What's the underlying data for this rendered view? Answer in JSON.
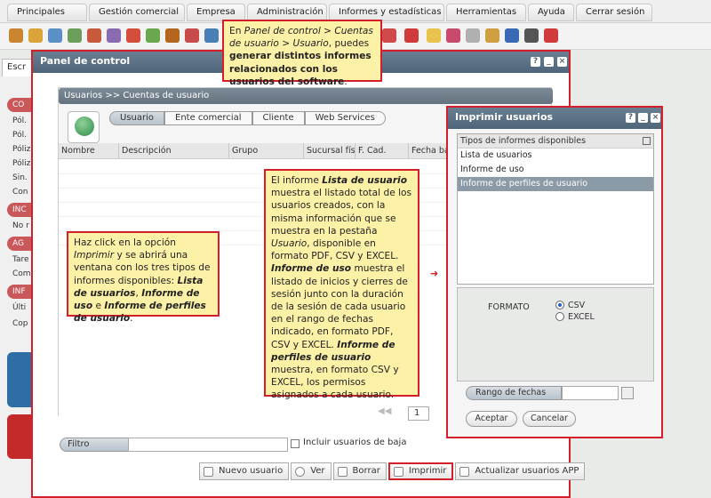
{
  "menu": [
    "Principales",
    "Gestión comercial",
    "Empresa",
    "Administración",
    "Informes y estadísticas",
    "Herramientas",
    "Ayuda",
    "Cerrar sesión"
  ],
  "background_tab": "Escr",
  "background_rows": [
    "CO",
    "Pól.",
    "Pól.",
    "Póliz",
    "Póliz",
    "Sin.",
    "Con",
    "INC",
    "No r",
    "AG",
    "Tare",
    "Com",
    "INF",
    "Últi",
    "Cop"
  ],
  "panel": {
    "title": "Panel de control",
    "section_title": "Usuarios >> Cuentas de usuario",
    "tabs": [
      "Usuario",
      "Ente comercial",
      "Cliente",
      "Web Services"
    ],
    "columns": [
      "Nombre",
      "Descripción",
      "Grupo",
      "Sucursal físi",
      "F. Cad.",
      "Fecha baja"
    ],
    "page_value": "1",
    "filter_label": "Filtro",
    "include_inactive_label": "Incluir usuarios de baja",
    "buttons": {
      "new_user": "Nuevo usuario",
      "view": "Ver",
      "delete": "Borrar",
      "print": "Imprimir",
      "update_app": "Actualizar usuarios APP"
    }
  },
  "callouts": {
    "top": {
      "p1": "En ",
      "i1": "Panel de control > Cuentas de usuario > Usuario",
      "p2": ", puedes ",
      "b1": "generar distintos informes relacionados con los usuarios del software",
      "p3": "."
    },
    "left": {
      "p1": "Haz click en la opción ",
      "i1": "Imprimir",
      "p2": " y se abrirá una ventana con los tres tipos de informes disponibles: ",
      "b1": "Lista de usuarios",
      "p3": ", ",
      "b2": "Informe de uso",
      "p4": " e ",
      "b3": "Informe de perfiles de usuario",
      "p5": "."
    },
    "middle": {
      "p1": "El informe ",
      "b1": "Lista de usuario",
      "p2": " muestra el listado total de los usuarios creados, con la misma información que se muestra en la pestaña ",
      "i1": "Usuario",
      "p3": ", disponible en formato PDF, CSV y EXCEL. ",
      "b2": "Informe de uso",
      "p4": " muestra el listado de inicios y cierres de sesión junto con la duración de la sesión de cada usuario en el rango de fechas indicado, en formato PDF, CSV y EXCEL. ",
      "b3": "Informe de perfiles de usuario",
      "p5": " muestra, en formato CSV y EXCEL, los permisos asignados a cada usuario."
    }
  },
  "dialog": {
    "title": "Imprimir usuarios",
    "list_header": "Tipos de informes disponibles",
    "items": [
      "Lista de usuarios",
      "Informe de uso",
      "Informe de perfiles de usuario"
    ],
    "selected_index": 2,
    "format_label": "FORMATO",
    "formats": [
      "CSV",
      "EXCEL"
    ],
    "selected_format": "CSV",
    "date_range_label": "Rango de fechas",
    "accept": "Aceptar",
    "cancel": "Cancelar"
  },
  "colors": {
    "highlight": "#d21f2a",
    "callout_bg": "#fdf1a8",
    "title_bar": "#4e6478"
  }
}
